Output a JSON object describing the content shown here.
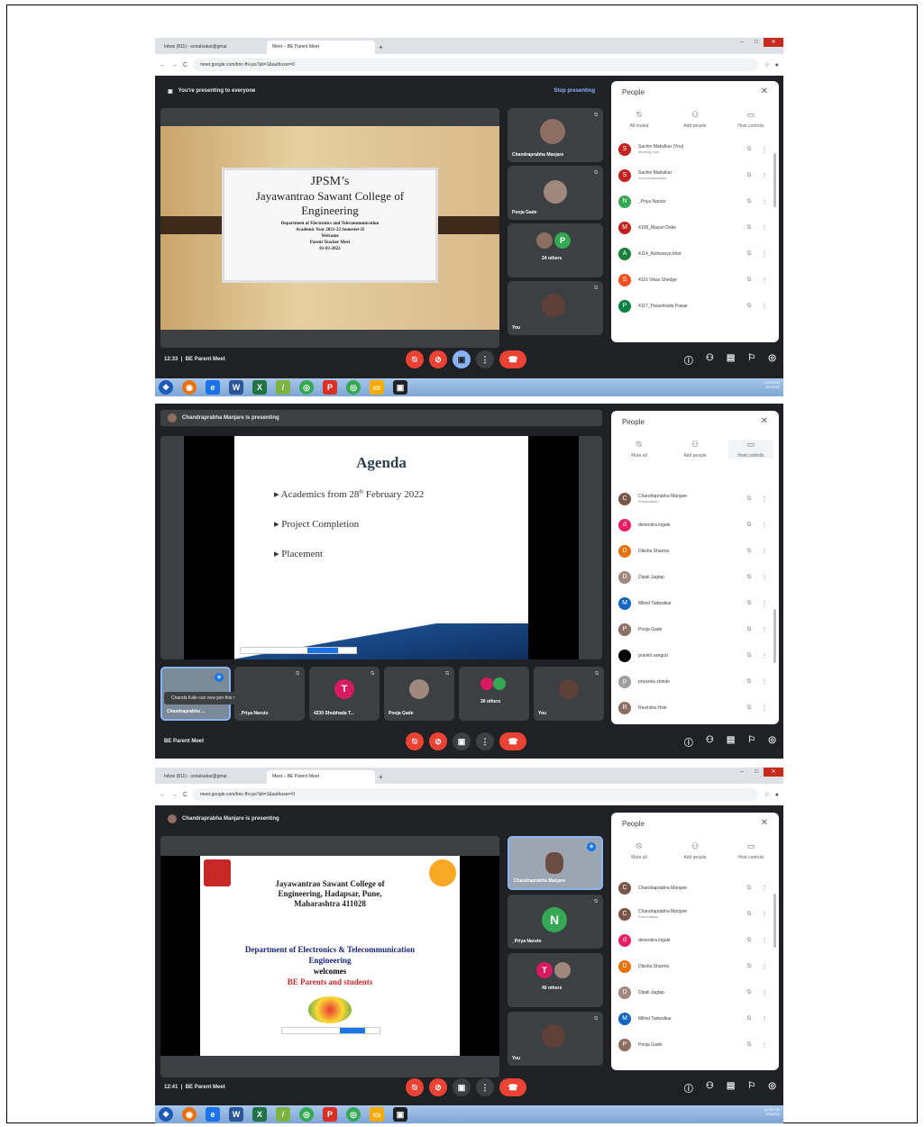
{
  "browser": {
    "tab1": "Inbox (811) - sonalsukar@gmai",
    "tab2": "Meet – BE Parent Meet",
    "new_tab": "+",
    "url": "meet.google.com/bnc-fhi-jus?pli=1&authuser=0"
  },
  "shot1": {
    "presenting_banner": "You're presenting to everyone",
    "stop_label": "Stop presenting",
    "slide": {
      "line1": "JPSM’s",
      "line2": "Jayawantrao Sawant College of",
      "line3": "Engineering",
      "line4": "Department of Electronics and Telecommunication",
      "line5": "Academic Year 2021-22 Semester-II",
      "line6": "Welcome",
      "line7": "Parent Teacher Meet",
      "line8": "01-03-2022"
    },
    "tiles": [
      {
        "name": "Chandraprabha Manjare"
      },
      {
        "name": "Pooja Gade"
      },
      {
        "name": "24 others",
        "initial": "P"
      },
      {
        "name": "You"
      }
    ],
    "time": "12:33",
    "meeting": "BE Parent Meet",
    "people": {
      "title": "People",
      "tools": [
        "All muted",
        "Add people",
        "Host controls"
      ],
      "rows": [
        {
          "name": "Sachin Mahulkar (You)",
          "sub": "Meeting host",
          "color": "#c5221f",
          "initial": "S"
        },
        {
          "name": "Sachin Mahulkar",
          "sub": "Your presentation",
          "color": "#c5221f",
          "initial": "S"
        },
        {
          "name": "_Priya Naruto",
          "sub": "",
          "color": "#34a853",
          "initial": "N"
        },
        {
          "name": "4108_Mayuri Doke",
          "sub": "",
          "color": "#c5221f",
          "initial": "M"
        },
        {
          "name": "4114_Aishwarya khot",
          "sub": "",
          "color": "#188038",
          "initial": "A"
        },
        {
          "name": "4116 Vikas Shedge",
          "sub": "",
          "color": "#f4511e",
          "initial": "S"
        },
        {
          "name": "4117_Parashrada Pawar",
          "sub": "",
          "color": "#0b8043",
          "initial": "P"
        }
      ]
    }
  },
  "shot2": {
    "presenting_banner": "Chandraprabha Manjare is presenting",
    "slide": {
      "title": "Agenda",
      "bullet1": "Academics from 28",
      "bullet1_sup": "th",
      "bullet1_tail": " February 2022",
      "bullet2": "Project Completion",
      "bullet3": "Placement"
    },
    "toast": "Chanda Kale can now join this meeting",
    "tiles": [
      {
        "name": "Chandraprabha ..."
      },
      {
        "name": "_Priya Naruto"
      },
      {
        "name": "4230 Shubhada T...",
        "initial": "T"
      },
      {
        "name": "Pooja Gade"
      },
      {
        "name": "30 others"
      },
      {
        "name": "You"
      }
    ],
    "meeting": "BE Parent Meet",
    "people": {
      "title": "People",
      "tools": [
        "Mute all",
        "Add people",
        "Host controls"
      ],
      "rows": [
        {
          "name": "Chandraprabha Manjare",
          "sub": "Presentation",
          "color": "#795548",
          "initial": "C"
        },
        {
          "name": "devendra ingale",
          "sub": "",
          "color": "#e91e63",
          "initial": "d"
        },
        {
          "name": "Diksha Sharma",
          "sub": "",
          "color": "#e8710a",
          "initial": "D"
        },
        {
          "name": "Dipali Jagtap",
          "sub": "",
          "color": "#a1887f",
          "initial": "D"
        },
        {
          "name": "Milind Tadwalkar",
          "sub": "",
          "color": "#1565c0",
          "initial": "M"
        },
        {
          "name": "Pooja Gade",
          "sub": "",
          "color": "#8d6e63",
          "initial": "P"
        },
        {
          "name": "prankit sangod",
          "sub": "",
          "color": "#000000",
          "initial": ""
        },
        {
          "name": "priyanka shinde",
          "sub": "",
          "color": "#9e9e9e",
          "initial": "p"
        },
        {
          "name": "Ravindra Hole",
          "sub": "",
          "color": "#8d6e63",
          "initial": "R"
        }
      ]
    }
  },
  "shot3": {
    "presenting_banner": "Chandraprabha Manjare is presenting",
    "slide": {
      "college1": "Jayawantrao Sawant College of",
      "college2": "Engineering, Hadapsar, Pune,",
      "college3": "Maharashtra 411028",
      "dept1": "Department of Electronics & Telecommunication",
      "dept2": "Engineering",
      "dept3": "welcomes",
      "dept4": "BE Parents and students"
    },
    "tiles": [
      {
        "name": "Chandraprabha Manjare"
      },
      {
        "name": "_Priya Naruto",
        "initial": "N"
      },
      {
        "name": "40 others",
        "initial": "T"
      },
      {
        "name": "You"
      }
    ],
    "time": "12:41",
    "meeting": "BE Parent Meet",
    "people": {
      "title": "People",
      "tools": [
        "Mute all",
        "Add people",
        "Host controls"
      ],
      "rows": [
        {
          "name": "Chandraprabha Manjare",
          "sub": "",
          "color": "#795548",
          "initial": "C"
        },
        {
          "name": "Chandraprabha Manjare",
          "sub": "Presentation",
          "color": "#795548",
          "initial": "C"
        },
        {
          "name": "devendra ingale",
          "sub": "",
          "color": "#e91e63",
          "initial": "d"
        },
        {
          "name": "Diksha Sharma",
          "sub": "",
          "color": "#e8710a",
          "initial": "D"
        },
        {
          "name": "Dipali Jagtap",
          "sub": "",
          "color": "#a1887f",
          "initial": "D"
        },
        {
          "name": "Milind Tadwalkar",
          "sub": "",
          "color": "#1565c0",
          "initial": "M"
        },
        {
          "name": "Pooja Gade",
          "sub": "",
          "color": "#8d6e63",
          "initial": "P"
        }
      ]
    }
  },
  "taskbar": {
    "tray_time1": "12:33 PM",
    "tray_time3": "12:41 PM",
    "tray_date": "3/1/2022"
  }
}
